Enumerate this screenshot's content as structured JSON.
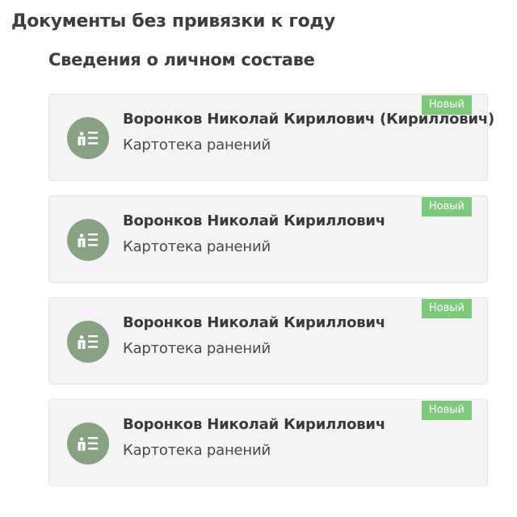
{
  "section": {
    "title": "Документы без привязки к году"
  },
  "subsection": {
    "title": "Сведения о личном составе"
  },
  "colors": {
    "badge": "#7ec97c",
    "icon_circle": "#88a183",
    "card_background": "#f4f4f4"
  },
  "cards": [
    {
      "name": "Воронков Николай Кирилович (Кириллович)",
      "type": "Картотека ранений",
      "badge": "Новый",
      "icon": "personnel-card-icon"
    },
    {
      "name": "Воронков Николай Кириллович",
      "type": "Картотека ранений",
      "badge": "Новый",
      "icon": "personnel-card-icon"
    },
    {
      "name": "Воронков Николай Кириллович",
      "type": "Картотека ранений",
      "badge": "Новый",
      "icon": "personnel-card-icon"
    },
    {
      "name": "Воронков Николай Кириллович",
      "type": "Картотека ранений",
      "badge": "Новый",
      "icon": "personnel-card-icon"
    }
  ]
}
